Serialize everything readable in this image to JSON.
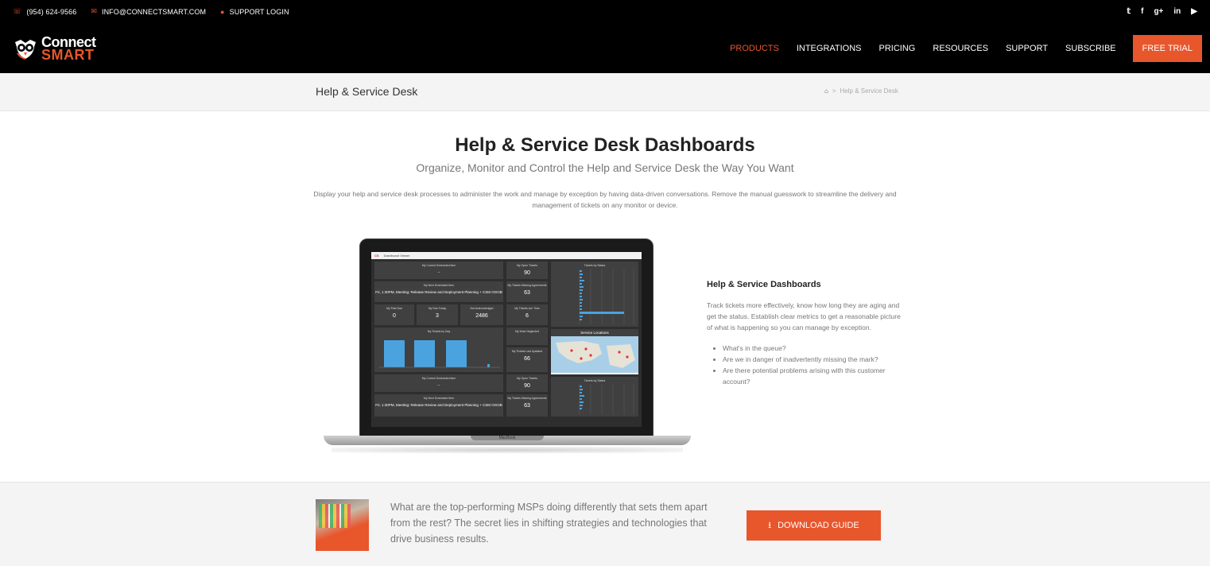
{
  "topbar": {
    "phone": "(954) 624-9566",
    "email": "INFO@CONNECTSMART.COM",
    "support_login": "SUPPORT LOGIN",
    "social": [
      "twitter-icon",
      "facebook-icon",
      "google-plus-icon",
      "linkedin-icon",
      "youtube-icon"
    ],
    "social_glyphs": [
      "𝕥",
      "f",
      "g+",
      "in",
      "▶"
    ]
  },
  "nav": {
    "logo_line1": "Connect",
    "logo_line2": "SMART",
    "items": [
      "PRODUCTS",
      "INTEGRATIONS",
      "PRICING",
      "RESOURCES",
      "SUPPORT",
      "SUBSCRIBE"
    ],
    "cta": "FREE TRIAL"
  },
  "titlebar": {
    "title": "Help & Service Desk",
    "breadcrumb_current": "Help & Service Desk",
    "breadcrumb_sep": ">"
  },
  "hero": {
    "title": "Help & Service Desk Dashboards",
    "subtitle": "Organize, Monitor and Control the Help and Service Desk the Way You Want",
    "description": "Display your help and service desk processes to administer the work and manage by exception by having data-driven conversations. Remove the manual guesswork to streamline the delivery and management of tickets on any monitor or device."
  },
  "laptop": {
    "brand": "MacBook",
    "screen_header": "Dashboard Viewer",
    "panels": {
      "current_label": "My Current Scheduled Item",
      "current_value": "--",
      "open_label": "My Open Tickets",
      "open_value": "90",
      "next_label": "My Next Scheduled Item",
      "next_value": "Fri, 1:30PM, Meeting: Release Review and Deployment Planning + CSM OGOB",
      "missing_label": "My Tickets Missing Agreements",
      "missing_value": "63",
      "pastdue_label": "My Past Due",
      "pastdue_value": "0",
      "duetoday_label": "My Due Today",
      "duetoday_value": "3",
      "notack_label": "Not Acknowledged",
      "notack_value": "2486",
      "ontime_label": "My Tickets w/o Time",
      "ontime_value": "6",
      "byday_label": "My Tickets by Day",
      "neglected_label": "My Most Neglected",
      "lastupdated_label": "My Tickets Last Updated",
      "lastupdated_value": "66",
      "status_label": "Tickets by Status",
      "locations_label": "Service Locations"
    }
  },
  "side": {
    "heading": "Help & Service Dashboards",
    "paragraph": "Track tickets more effectively, know how long they are aging and get the status. Establish clear metrics to get a reasonable picture of what is happening so you can manage by exception.",
    "bullets": [
      "What's in the queue?",
      "Are we in danger of inadvertently missing the mark?",
      "Are there potential problems arising with this customer account?"
    ]
  },
  "band": {
    "text": "What are the top-performing MSPs doing differently that sets them apart from the rest? The secret lies in shifting strategies and technologies that drive business results.",
    "button": "DOWNLOAD GUIDE"
  },
  "colors": {
    "accent": "#e8562c",
    "black": "#000000",
    "muted_text": "#777777"
  }
}
